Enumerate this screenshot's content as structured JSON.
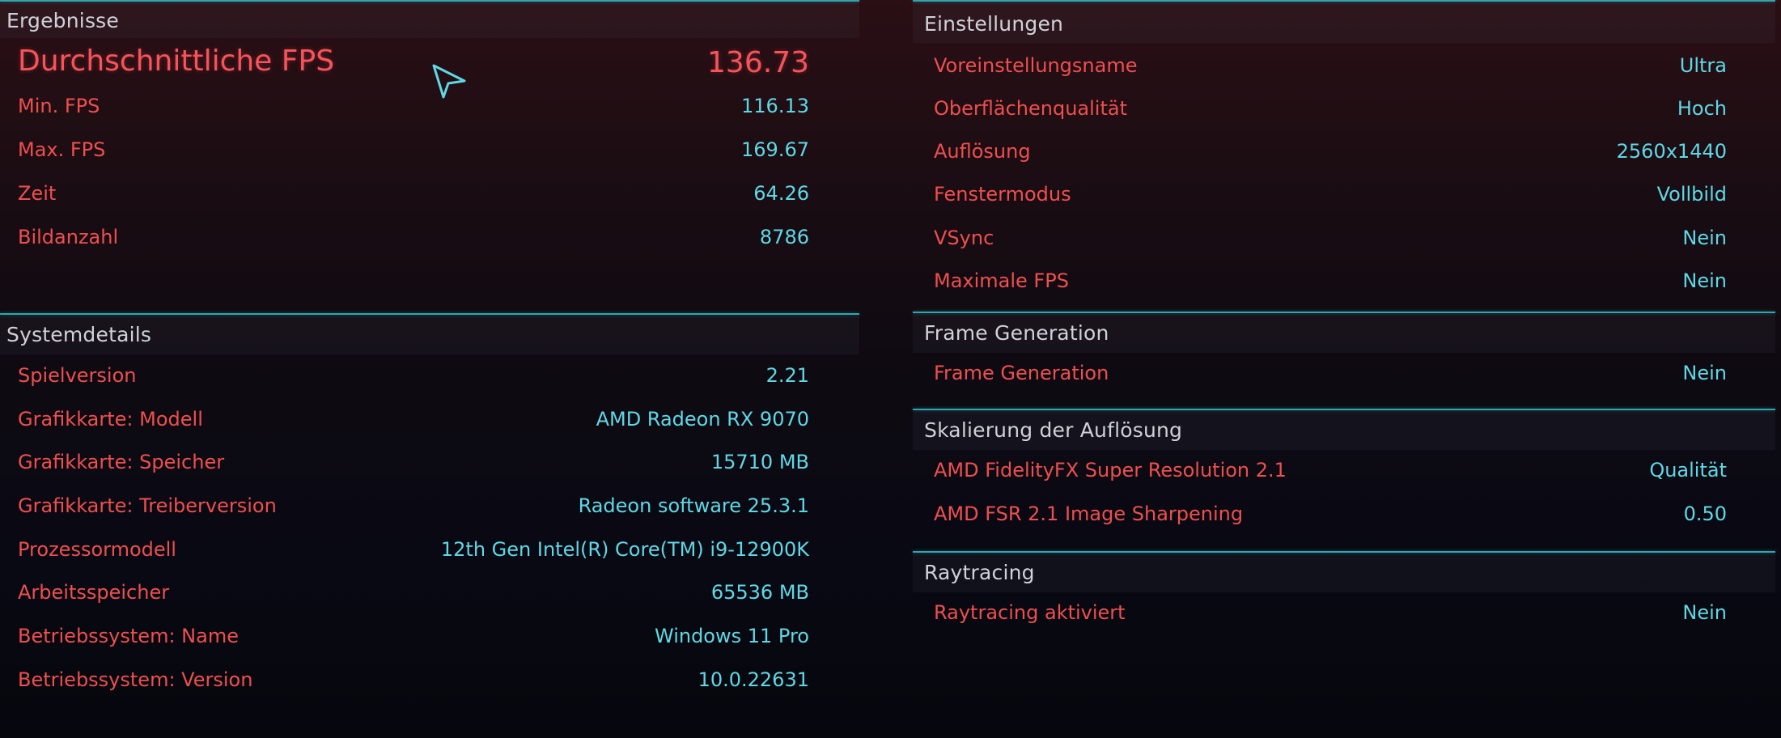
{
  "ergebnisse": {
    "title": "Ergebnisse",
    "rows": [
      {
        "label": "Durchschnittliche FPS",
        "value": "136.73"
      },
      {
        "label": "Min. FPS",
        "value": "116.13"
      },
      {
        "label": "Max. FPS",
        "value": "169.67"
      },
      {
        "label": "Zeit",
        "value": "64.26"
      },
      {
        "label": "Bildanzahl",
        "value": "8786"
      }
    ]
  },
  "systemdetails": {
    "title": "Systemdetails",
    "rows": [
      {
        "label": "Spielversion",
        "value": "2.21"
      },
      {
        "label": "Grafikkarte: Modell",
        "value": "AMD Radeon RX 9070"
      },
      {
        "label": "Grafikkarte: Speicher",
        "value": "15710 MB"
      },
      {
        "label": "Grafikkarte: Treiberversion",
        "value": "Radeon software 25.3.1"
      },
      {
        "label": "Prozessormodell",
        "value": "12th Gen Intel(R) Core(TM) i9-12900K"
      },
      {
        "label": "Arbeitsspeicher",
        "value": "65536 MB"
      },
      {
        "label": "Betriebssystem: Name",
        "value": "Windows 11 Pro"
      },
      {
        "label": "Betriebssystem: Version",
        "value": "10.0.22631"
      }
    ]
  },
  "einstellungen": {
    "title": "Einstellungen",
    "rows": [
      {
        "label": "Voreinstellungsname",
        "value": "Ultra"
      },
      {
        "label": "Oberflächenqualität",
        "value": "Hoch"
      },
      {
        "label": "Auflösung",
        "value": "2560x1440"
      },
      {
        "label": "Fenstermodus",
        "value": "Vollbild"
      },
      {
        "label": "VSync",
        "value": "Nein"
      },
      {
        "label": "Maximale FPS",
        "value": "Nein"
      }
    ]
  },
  "frame_generation": {
    "title": "Frame Generation",
    "rows": [
      {
        "label": "Frame Generation",
        "value": "Nein"
      }
    ]
  },
  "skalierung": {
    "title": "Skalierung der Auflösung",
    "rows": [
      {
        "label": "AMD FidelityFX Super Resolution 2.1",
        "value": "Qualität"
      },
      {
        "label": "AMD FSR 2.1 Image Sharpening",
        "value": "0.50"
      }
    ]
  },
  "raytracing": {
    "title": "Raytracing",
    "rows": [
      {
        "label": "Raytracing aktiviert",
        "value": "Nein"
      }
    ]
  },
  "cursor": {
    "icon": "pointer-arrow-icon",
    "color": "#5fd8e6"
  },
  "colors": {
    "label": "#ee4f4f",
    "value": "#5fd8e6",
    "accent_rule": "#2ea7b0",
    "section_title": "#d0d2d8"
  }
}
